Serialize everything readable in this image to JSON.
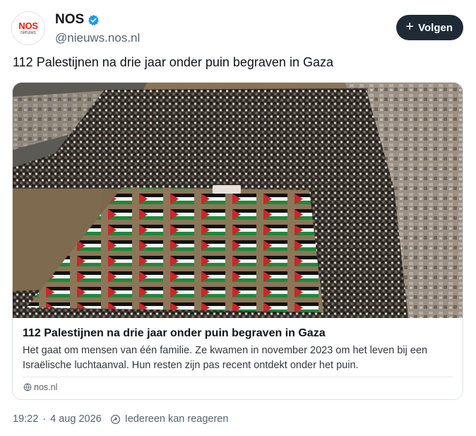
{
  "account": {
    "display_name": "NOS",
    "handle": "@nieuws.nos.nl",
    "avatar_logo": "NOS",
    "avatar_logo_sub": "nieuws",
    "verified": true
  },
  "actions": {
    "follow_label": "Volgen"
  },
  "post": {
    "text": "112 Palestijnen na drie jaar onder puin begraven in Gaza"
  },
  "link_card": {
    "title": "112 Palestijnen na drie jaar onder puin begraven in Gaza",
    "description": "Het gaat om mensen van één familie. Ze kwamen in november 2023 om het leven bij een Israëlische luchtaanval. Hun resten zijn pas recent ontdekt onder het puin.",
    "source": "nos.nl",
    "image_subject": "aerial photo of a funeral with rows of bodies wrapped in Palestinian flags surrounded by a crowd"
  },
  "meta": {
    "time": "19:22",
    "separator": "·",
    "date": "4 aug 2026",
    "reply_setting": "Iedereen kan reageren"
  },
  "colors": {
    "accent_dark": "#1f2a37",
    "verified_blue": "#1d9bf0",
    "nos_red": "#e2231a",
    "secondary_text": "#536471"
  }
}
